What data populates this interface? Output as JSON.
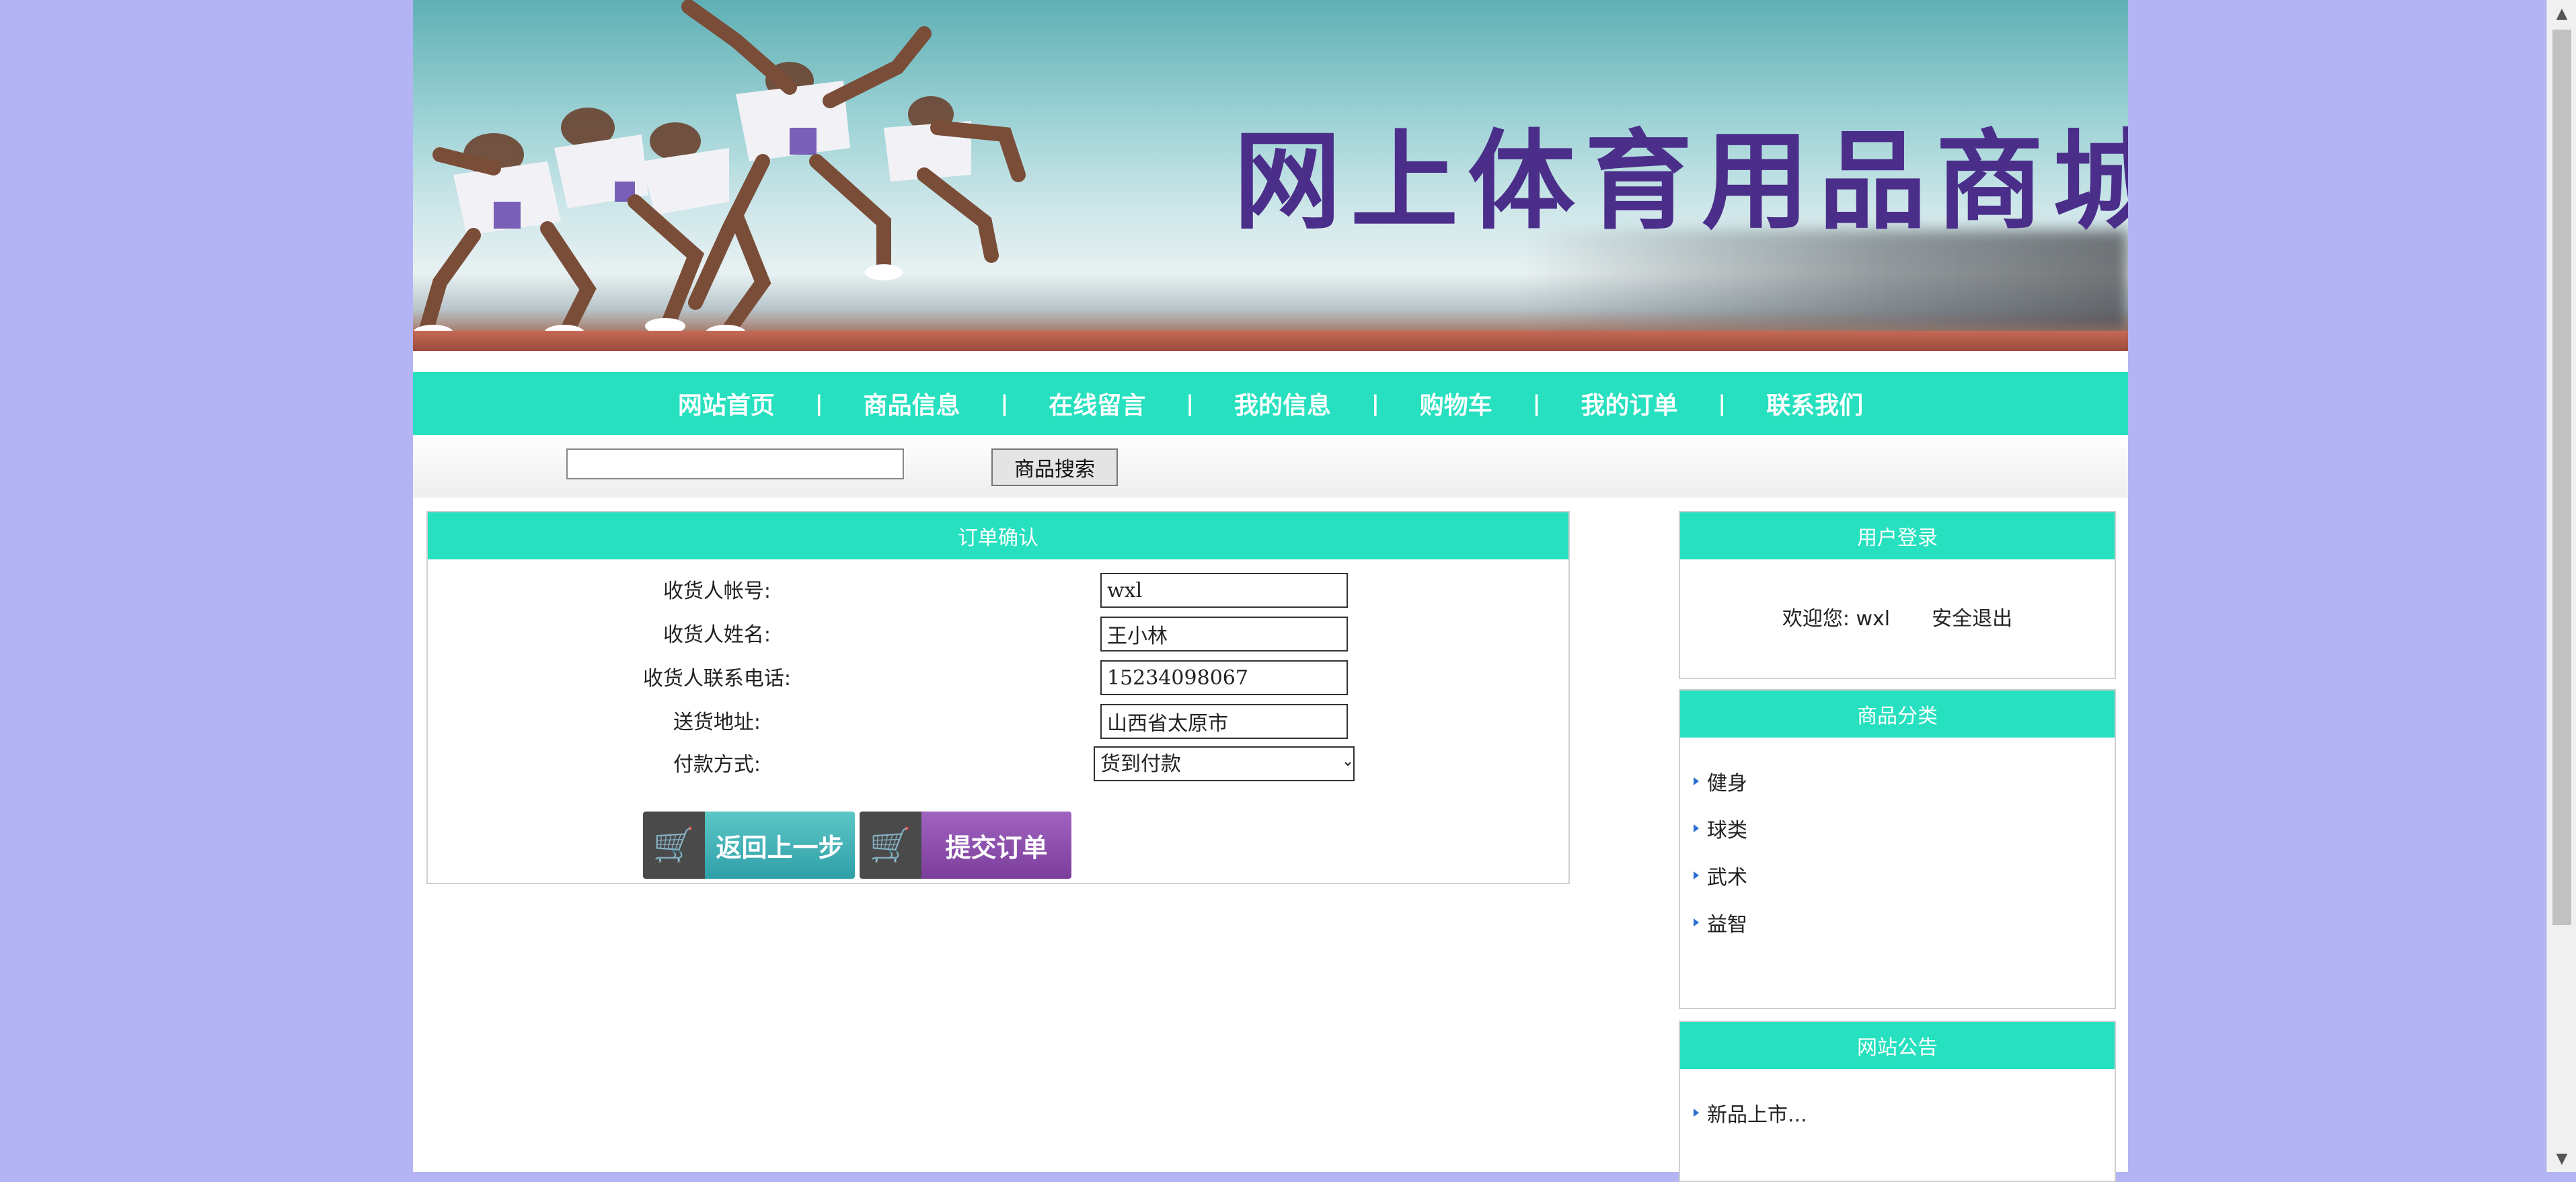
{
  "banner": {
    "title": "网上体育用品商城"
  },
  "nav": {
    "items": [
      "网站首页",
      "商品信息",
      "在线留言",
      "我的信息",
      "购物车",
      "我的订单",
      "联系我们"
    ],
    "separator": "|"
  },
  "search": {
    "value": "",
    "button": "商品搜索"
  },
  "order": {
    "title": "订单确认",
    "fields": [
      {
        "label": "收货人帐号:",
        "value": "wxl"
      },
      {
        "label": "收货人姓名:",
        "value": "王小林"
      },
      {
        "label": "收货人联系电话:",
        "value": "15234098067"
      },
      {
        "label": "送货地址:",
        "value": "山西省太原市"
      }
    ],
    "payment": {
      "label": "付款方式:",
      "selected": "货到付款"
    },
    "back_button": "返回上一步",
    "submit_button": "提交订单"
  },
  "login": {
    "title": "用户登录",
    "welcome": "欢迎您: wxl",
    "logout": "安全退出"
  },
  "categories": {
    "title": "商品分类",
    "items": [
      "健身",
      "球类",
      "武术",
      "益智"
    ]
  },
  "notice": {
    "title": "网站公告",
    "items": [
      "新品上市..."
    ]
  },
  "colors": {
    "accent": "#27e0bf",
    "page_bg": "#b3b4f4",
    "title": "#4b2e8a"
  }
}
